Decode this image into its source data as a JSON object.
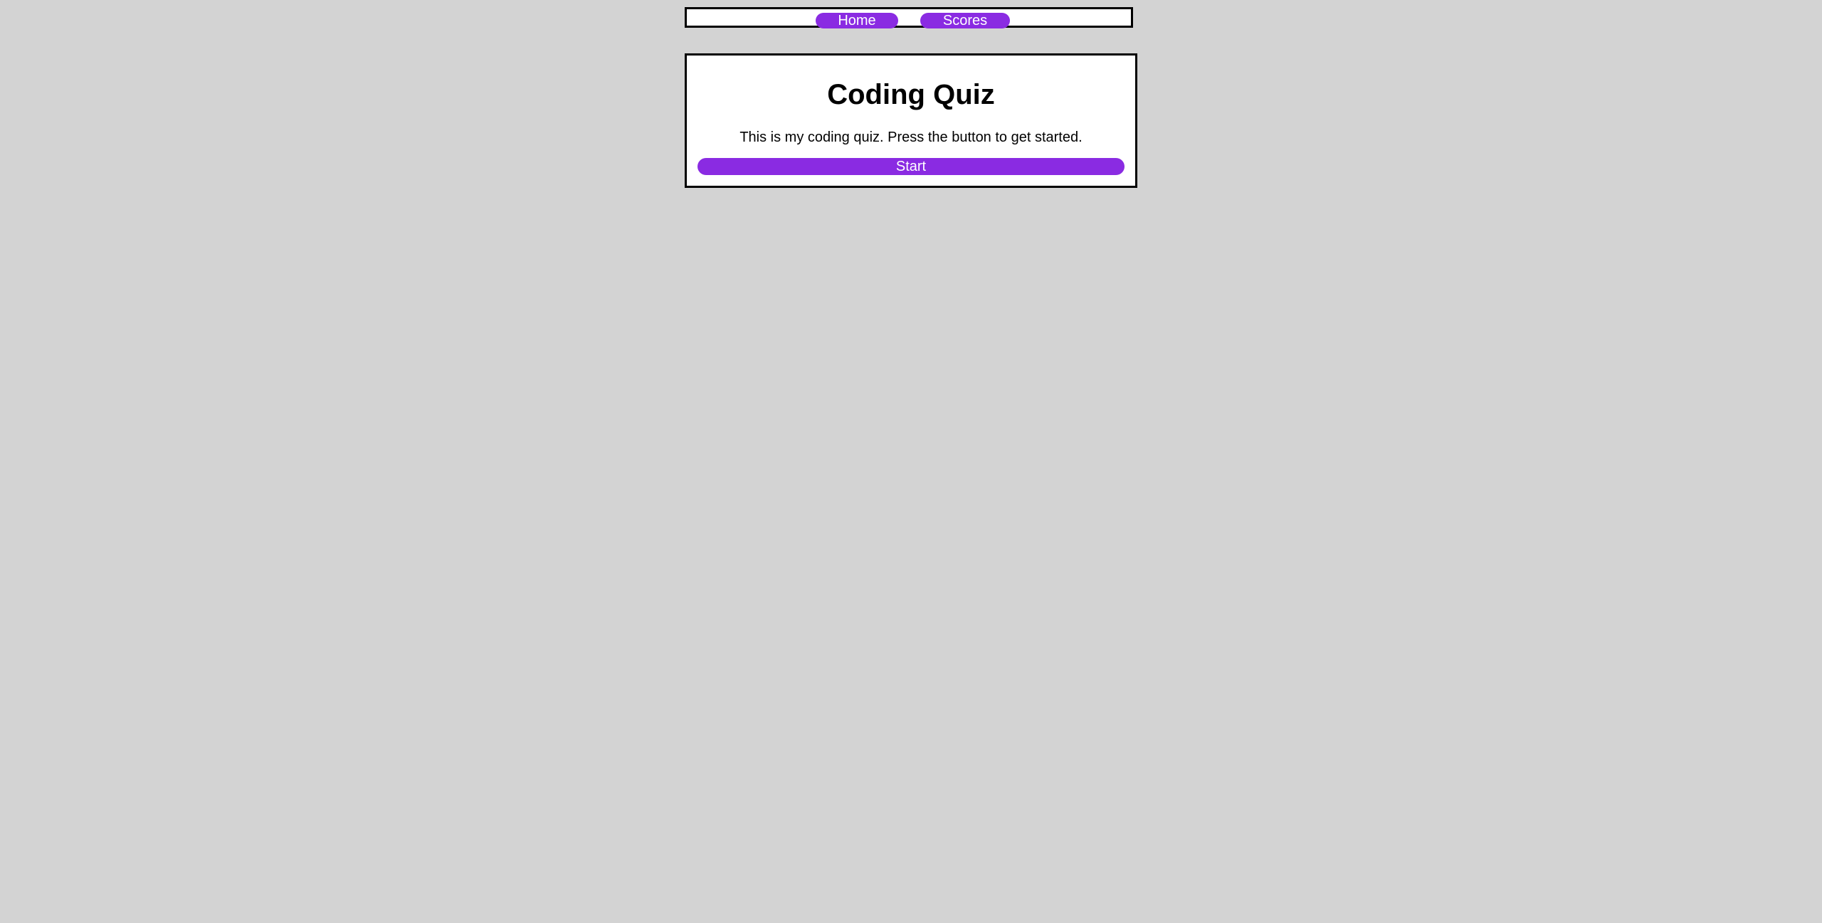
{
  "nav": {
    "home_label": "Home",
    "scores_label": "Scores"
  },
  "quiz": {
    "title": "Coding Quiz",
    "description": "This is my coding quiz. Press the button to get started.",
    "start_label": "Start"
  },
  "colors": {
    "background": "#d3d3d3",
    "accent": "#8a2be2",
    "panel": "#ffffff",
    "border": "#000000"
  }
}
